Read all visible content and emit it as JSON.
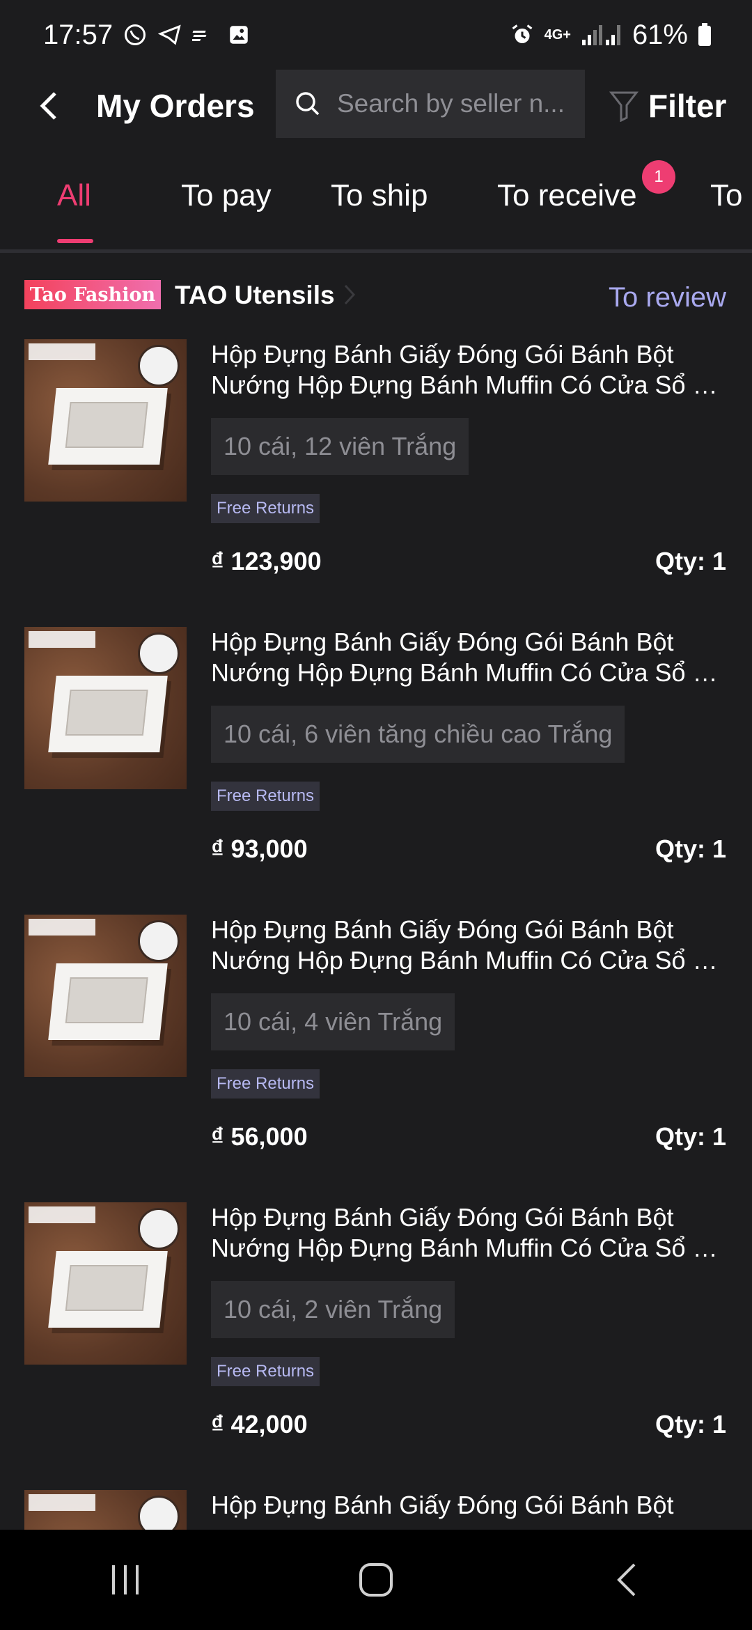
{
  "status_bar": {
    "time": "17:57",
    "network": "4G+",
    "battery": "61%"
  },
  "header": {
    "title": "My Orders",
    "search_placeholder": "Search by seller n...",
    "filter_label": "Filter"
  },
  "tabs": [
    {
      "label": "All",
      "active": true
    },
    {
      "label": "To pay"
    },
    {
      "label": "To ship"
    },
    {
      "label": "To receive",
      "badge": "1"
    },
    {
      "label": "To"
    }
  ],
  "shop": {
    "logo_text": "Tao Fashion",
    "name": "TAO Utensils",
    "action": "To review"
  },
  "items": [
    {
      "title_line1": "Hộp Đựng Bánh Giấy Đóng Gói Bánh Bột",
      "title_line2": "Nướng Hộp Đựng Bánh Muffin Có Cửa Sổ H...",
      "variant": "10 cái, 12 viên Trắng",
      "tag": "Free Returns",
      "price": "₫ 123,900",
      "qty": "Qty: 1"
    },
    {
      "title_line1": "Hộp Đựng Bánh Giấy Đóng Gói Bánh Bột",
      "title_line2": "Nướng Hộp Đựng Bánh Muffin Có Cửa Sổ H...",
      "variant": "10 cái, 6 viên tăng chiều cao Trắng",
      "tag": "Free Returns",
      "price": "₫ 93,000",
      "qty": "Qty: 1"
    },
    {
      "title_line1": "Hộp Đựng Bánh Giấy Đóng Gói Bánh Bột",
      "title_line2": "Nướng Hộp Đựng Bánh Muffin Có Cửa Sổ H...",
      "variant": "10 cái, 4 viên Trắng",
      "tag": "Free Returns",
      "price": "₫ 56,000",
      "qty": "Qty: 1"
    },
    {
      "title_line1": "Hộp Đựng Bánh Giấy Đóng Gói Bánh Bột",
      "title_line2": "Nướng Hộp Đựng Bánh Muffin Có Cửa Sổ H...",
      "variant": "10 cái, 2 viên Trắng",
      "tag": "Free Returns",
      "price": "₫ 42,000",
      "qty": "Qty: 1"
    },
    {
      "title_line1": "Hộp Đựng Bánh Giấy Đóng Gói Bánh Bột"
    }
  ],
  "colors": {
    "accent": "#ee3d72",
    "link": "#a9a9ef",
    "background": "#1c1c1e"
  },
  "icons": [
    "whatsapp-icon",
    "telegram-icon",
    "wind-icon",
    "gallery-icon",
    "alarm-icon",
    "signal-icon",
    "battery-icon",
    "back-icon",
    "search-icon",
    "filter-icon",
    "chevron-right-icon",
    "recent-apps-icon",
    "home-icon"
  ]
}
